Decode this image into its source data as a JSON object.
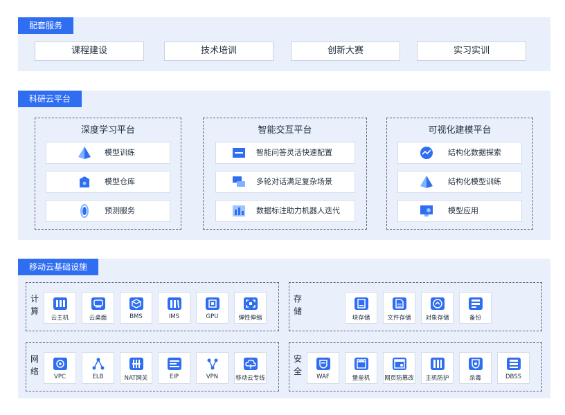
{
  "supporting": {
    "title": "配套服务",
    "items": [
      "课程建设",
      "技术培训",
      "创新大赛",
      "实习实训"
    ]
  },
  "research": {
    "title": "科研云平台",
    "platforms": [
      {
        "title": "深度学习平台",
        "items": [
          {
            "label": "模型训练",
            "icon": "pyramid-icon"
          },
          {
            "label": "模型仓库",
            "icon": "storage-box-icon"
          },
          {
            "label": "预测服务",
            "icon": "orbit-icon"
          }
        ]
      },
      {
        "title": "智能交互平台",
        "items": [
          {
            "label": "智能问答灵活快速配置",
            "icon": "window-icon"
          },
          {
            "label": "多轮对话满足复杂场景",
            "icon": "chat-bubbles-icon"
          },
          {
            "label": "数据标注助力机器人迭代",
            "icon": "chart-bars-icon"
          }
        ]
      },
      {
        "title": "可视化建模平台",
        "items": [
          {
            "label": "结构化数据探索",
            "icon": "trend-bubble-icon"
          },
          {
            "label": "结构化模型训练",
            "icon": "pyramid-icon"
          },
          {
            "label": "模型应用",
            "icon": "monitor-icon"
          }
        ]
      }
    ]
  },
  "infra": {
    "title": "移动云基础设施",
    "groups": [
      {
        "title": "计算",
        "items": [
          {
            "label": "云主机",
            "icon": "server-icon"
          },
          {
            "label": "云桌面",
            "icon": "desktop-icon"
          },
          {
            "label": "BMS",
            "icon": "cube-icon"
          },
          {
            "label": "IMS",
            "icon": "books-icon"
          },
          {
            "label": "GPU",
            "icon": "chip-icon"
          },
          {
            "label": "弹性伸缩",
            "icon": "expand-icon"
          }
        ]
      },
      {
        "title": "存储",
        "items": [
          {
            "label": "块存储",
            "icon": "disk-icon"
          },
          {
            "label": "文件存储",
            "icon": "file-icon"
          },
          {
            "label": "对象存储",
            "icon": "cloud-storage-icon"
          },
          {
            "label": "备份",
            "icon": "backup-icon"
          }
        ]
      },
      {
        "title": "网络",
        "items": [
          {
            "label": "VPC",
            "icon": "vpc-icon"
          },
          {
            "label": "ELB",
            "icon": "load-balancer-icon"
          },
          {
            "label": "NAT网关",
            "icon": "nat-gateway-icon"
          },
          {
            "label": "EIP",
            "icon": "eip-icon"
          },
          {
            "label": "VPN",
            "icon": "vpn-icon"
          },
          {
            "label": "移动云专线",
            "icon": "cloud-line-icon"
          }
        ]
      },
      {
        "title": "安全",
        "items": [
          {
            "label": "WAF",
            "icon": "waf-icon"
          },
          {
            "label": "堡垒机",
            "icon": "bastion-icon"
          },
          {
            "label": "网页防篡改",
            "icon": "web-protect-icon"
          },
          {
            "label": "主机防护",
            "icon": "host-protect-icon"
          },
          {
            "label": "杀毒",
            "icon": "antivirus-icon"
          },
          {
            "label": "DBSS",
            "icon": "database-icon"
          }
        ]
      }
    ]
  },
  "colors": {
    "accent": "#2f6df1",
    "panel": "#e9f0fc",
    "icon_light": "#7fb2ff"
  }
}
